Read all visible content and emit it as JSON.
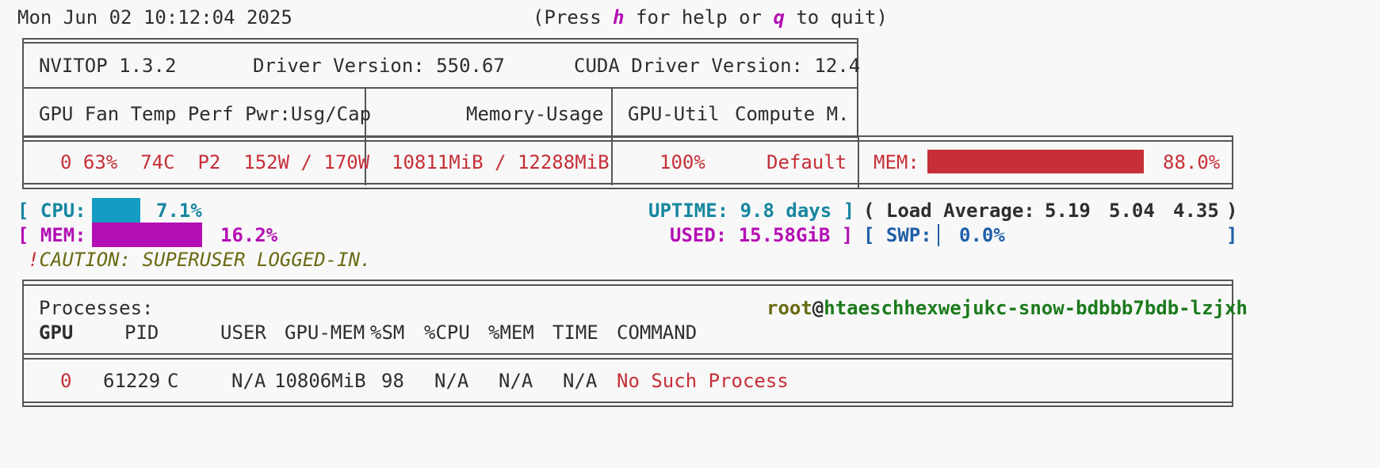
{
  "header": {
    "clock": "Mon Jun 02 10:12:04 2025",
    "help_open": "(Press ",
    "help_key": "h",
    "help_mid": " for help or ",
    "quit_key": "q",
    "help_close": " to quit)"
  },
  "summary": {
    "app": "NVITOP 1.3.2",
    "driver": "Driver Version: 550.67",
    "cuda": "CUDA Driver Version: 12.4"
  },
  "gpu_table": {
    "col1": "GPU Fan Temp Perf Pwr:Usg/Cap",
    "col2": "Memory-Usage",
    "col3_util": "GPU-Util",
    "col3_compute": "Compute M.",
    "row": {
      "gpu": "0",
      "fan": "63%",
      "temp": "74C",
      "perf": "P2",
      "power": "152W / 170W",
      "memory": "10811MiB / 12288MiB",
      "util": "100%",
      "compute_mode": "Default",
      "mem_label": "MEM:",
      "mem_percent": "88.0%",
      "mem_fraction": 0.88
    }
  },
  "host": {
    "cpu_open": "[ ",
    "cpu_label": "CPU:",
    "cpu_percent": "7.1%",
    "cpu_fraction": 0.071,
    "uptime_label": "UPTIME:",
    "uptime_value": "9.8 days",
    "uptime_close": "]",
    "load_label": "( Load Average:",
    "load_1": "5.19",
    "load_5": "5.04",
    "load_15": "4.35",
    "load_close": ")",
    "mem_open": "[ ",
    "mem_label": "MEM:",
    "mem_percent": "16.2%",
    "mem_fraction": 0.162,
    "used_label": "USED:",
    "used_value": "15.58GiB",
    "used_close": "]",
    "swp_open": "[",
    "swp_label": "SWP:",
    "swp_percent": "0.0%",
    "swp_close": "]",
    "caution_mark": "!",
    "caution_text": "CAUTION: SUPERUSER LOGGED-IN."
  },
  "processes": {
    "title": "Processes:",
    "user": "root",
    "at": "@",
    "hostname": "htaeschhexwejukc-snow-bdbbb7bdb-lzjxh",
    "columns": {
      "gpu": "GPU",
      "pid": "PID",
      "user": "USER",
      "gpu_mem": "GPU-MEM",
      "sm": "%SM",
      "cpu": "%CPU",
      "mem": "%MEM",
      "time": "TIME",
      "command": "COMMAND"
    },
    "rows": [
      {
        "gpu": "0",
        "pid": "61229",
        "type": "C",
        "user": "N/A",
        "gpu_mem": "10806MiB",
        "sm": "98",
        "cpu": "N/A",
        "mem": "N/A",
        "time": "N/A",
        "command": "No Such Process"
      }
    ]
  },
  "colors": {
    "gpu_row": "#c62f37",
    "cpu_accent": "#1786a0",
    "mem_accent": "#b40fb4",
    "swp_accent": "#1f5fa8",
    "caution": "#6b6a14",
    "hostname": "#1c7a1c"
  }
}
